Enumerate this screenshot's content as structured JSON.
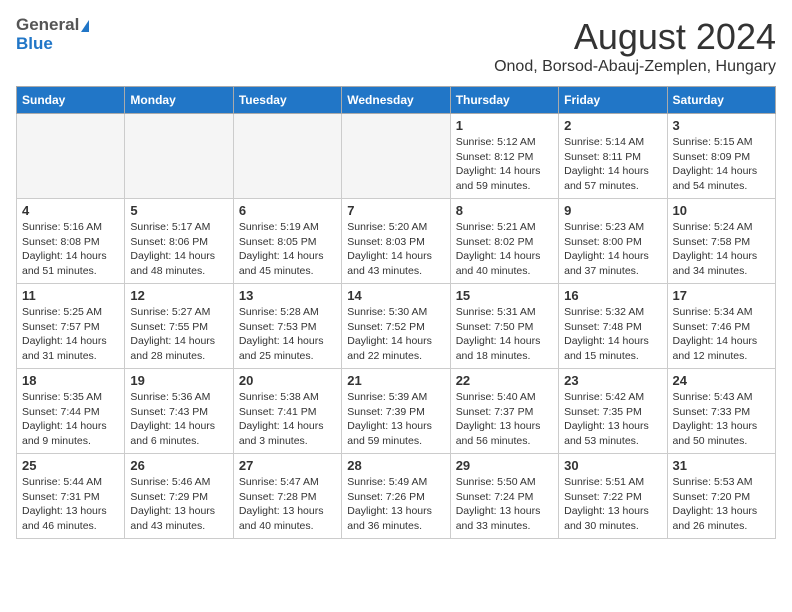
{
  "header": {
    "logo_line1": "General",
    "logo_line2": "Blue",
    "main_title": "August 2024",
    "subtitle": "Onod, Borsod-Abauj-Zemplen, Hungary"
  },
  "weekdays": [
    "Sunday",
    "Monday",
    "Tuesday",
    "Wednesday",
    "Thursday",
    "Friday",
    "Saturday"
  ],
  "weeks": [
    [
      {
        "day": "",
        "info": ""
      },
      {
        "day": "",
        "info": ""
      },
      {
        "day": "",
        "info": ""
      },
      {
        "day": "",
        "info": ""
      },
      {
        "day": "1",
        "info": "Sunrise: 5:12 AM\nSunset: 8:12 PM\nDaylight: 14 hours and 59 minutes."
      },
      {
        "day": "2",
        "info": "Sunrise: 5:14 AM\nSunset: 8:11 PM\nDaylight: 14 hours and 57 minutes."
      },
      {
        "day": "3",
        "info": "Sunrise: 5:15 AM\nSunset: 8:09 PM\nDaylight: 14 hours and 54 minutes."
      }
    ],
    [
      {
        "day": "4",
        "info": "Sunrise: 5:16 AM\nSunset: 8:08 PM\nDaylight: 14 hours and 51 minutes."
      },
      {
        "day": "5",
        "info": "Sunrise: 5:17 AM\nSunset: 8:06 PM\nDaylight: 14 hours and 48 minutes."
      },
      {
        "day": "6",
        "info": "Sunrise: 5:19 AM\nSunset: 8:05 PM\nDaylight: 14 hours and 45 minutes."
      },
      {
        "day": "7",
        "info": "Sunrise: 5:20 AM\nSunset: 8:03 PM\nDaylight: 14 hours and 43 minutes."
      },
      {
        "day": "8",
        "info": "Sunrise: 5:21 AM\nSunset: 8:02 PM\nDaylight: 14 hours and 40 minutes."
      },
      {
        "day": "9",
        "info": "Sunrise: 5:23 AM\nSunset: 8:00 PM\nDaylight: 14 hours and 37 minutes."
      },
      {
        "day": "10",
        "info": "Sunrise: 5:24 AM\nSunset: 7:58 PM\nDaylight: 14 hours and 34 minutes."
      }
    ],
    [
      {
        "day": "11",
        "info": "Sunrise: 5:25 AM\nSunset: 7:57 PM\nDaylight: 14 hours and 31 minutes."
      },
      {
        "day": "12",
        "info": "Sunrise: 5:27 AM\nSunset: 7:55 PM\nDaylight: 14 hours and 28 minutes."
      },
      {
        "day": "13",
        "info": "Sunrise: 5:28 AM\nSunset: 7:53 PM\nDaylight: 14 hours and 25 minutes."
      },
      {
        "day": "14",
        "info": "Sunrise: 5:30 AM\nSunset: 7:52 PM\nDaylight: 14 hours and 22 minutes."
      },
      {
        "day": "15",
        "info": "Sunrise: 5:31 AM\nSunset: 7:50 PM\nDaylight: 14 hours and 18 minutes."
      },
      {
        "day": "16",
        "info": "Sunrise: 5:32 AM\nSunset: 7:48 PM\nDaylight: 14 hours and 15 minutes."
      },
      {
        "day": "17",
        "info": "Sunrise: 5:34 AM\nSunset: 7:46 PM\nDaylight: 14 hours and 12 minutes."
      }
    ],
    [
      {
        "day": "18",
        "info": "Sunrise: 5:35 AM\nSunset: 7:44 PM\nDaylight: 14 hours and 9 minutes."
      },
      {
        "day": "19",
        "info": "Sunrise: 5:36 AM\nSunset: 7:43 PM\nDaylight: 14 hours and 6 minutes."
      },
      {
        "day": "20",
        "info": "Sunrise: 5:38 AM\nSunset: 7:41 PM\nDaylight: 14 hours and 3 minutes."
      },
      {
        "day": "21",
        "info": "Sunrise: 5:39 AM\nSunset: 7:39 PM\nDaylight: 13 hours and 59 minutes."
      },
      {
        "day": "22",
        "info": "Sunrise: 5:40 AM\nSunset: 7:37 PM\nDaylight: 13 hours and 56 minutes."
      },
      {
        "day": "23",
        "info": "Sunrise: 5:42 AM\nSunset: 7:35 PM\nDaylight: 13 hours and 53 minutes."
      },
      {
        "day": "24",
        "info": "Sunrise: 5:43 AM\nSunset: 7:33 PM\nDaylight: 13 hours and 50 minutes."
      }
    ],
    [
      {
        "day": "25",
        "info": "Sunrise: 5:44 AM\nSunset: 7:31 PM\nDaylight: 13 hours and 46 minutes."
      },
      {
        "day": "26",
        "info": "Sunrise: 5:46 AM\nSunset: 7:29 PM\nDaylight: 13 hours and 43 minutes."
      },
      {
        "day": "27",
        "info": "Sunrise: 5:47 AM\nSunset: 7:28 PM\nDaylight: 13 hours and 40 minutes."
      },
      {
        "day": "28",
        "info": "Sunrise: 5:49 AM\nSunset: 7:26 PM\nDaylight: 13 hours and 36 minutes."
      },
      {
        "day": "29",
        "info": "Sunrise: 5:50 AM\nSunset: 7:24 PM\nDaylight: 13 hours and 33 minutes."
      },
      {
        "day": "30",
        "info": "Sunrise: 5:51 AM\nSunset: 7:22 PM\nDaylight: 13 hours and 30 minutes."
      },
      {
        "day": "31",
        "info": "Sunrise: 5:53 AM\nSunset: 7:20 PM\nDaylight: 13 hours and 26 minutes."
      }
    ]
  ]
}
